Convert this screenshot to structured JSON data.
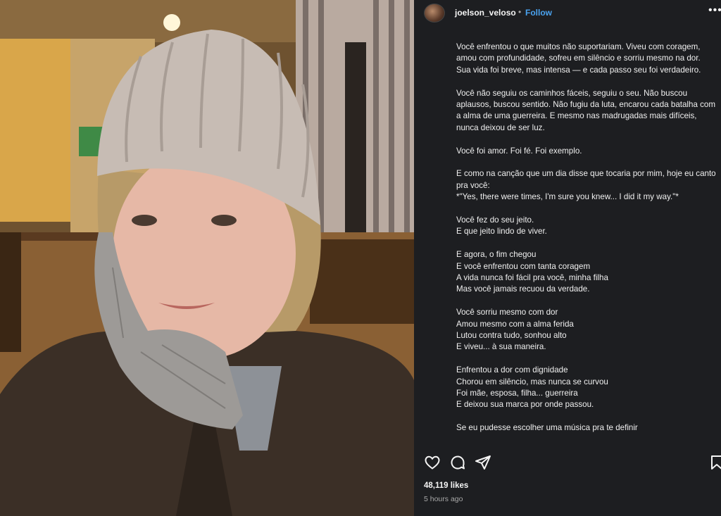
{
  "post": {
    "photo_alt": "Young woman wearing a knitted beige beanie and grey gloves, resting her chin on her hand"
  },
  "header": {
    "username": "joelson_veloso",
    "separator": "•",
    "follow_label": "Follow",
    "more_label": "•••"
  },
  "caption": {
    "paragraphs": [
      "Você enfrentou o que muitos não suportariam. Viveu com coragem, amou com profundidade, sofreu em silêncio e sorriu mesmo na dor. Sua vida foi breve, mas intensa — e cada passo seu foi verdadeiro.",
      "Você não seguiu os caminhos fáceis, seguiu o seu. Não buscou aplausos, buscou sentido. Não fugiu da luta, encarou cada batalha com a alma de uma guerreira. E mesmo nas madrugadas mais difíceis, nunca deixou de ser luz.",
      "Você foi amor. Foi fé. Foi exemplo.",
      "E como na canção que um dia disse que tocaria por mim, hoje eu canto pra você:\n*\"Yes, there were times, I'm sure you knew... I did it my way.\"*",
      "Você fez do seu jeito.\nE que jeito lindo de viver.",
      "E agora, o fim chegou\nE você enfrentou com tanta coragem\nA vida nunca foi fácil pra você, minha filha\nMas você jamais recuou da verdade.",
      "Você sorriu mesmo com dor\nAmou mesmo com a alma ferida\nLutou contra tudo, sonhou alto\nE viveu... à sua maneira.",
      "Enfrentou a dor com dignidade\nChorou em silêncio, mas nunca se curvou\nFoi mãe, esposa, filha... guerreira\nE deixou sua marca por onde passou.",
      "Se eu pudesse escolher uma música pra te definir"
    ]
  },
  "actions": {
    "like_icon": "heart-icon",
    "comment_icon": "comment-icon",
    "share_icon": "share-icon",
    "save_icon": "bookmark-icon"
  },
  "stats": {
    "likes": "48,119 likes",
    "timestamp": "5 hours ago"
  },
  "colors": {
    "panel_bg": "#1d1e21",
    "follow": "#4aa3f0",
    "muted": "#a8a8a8"
  }
}
